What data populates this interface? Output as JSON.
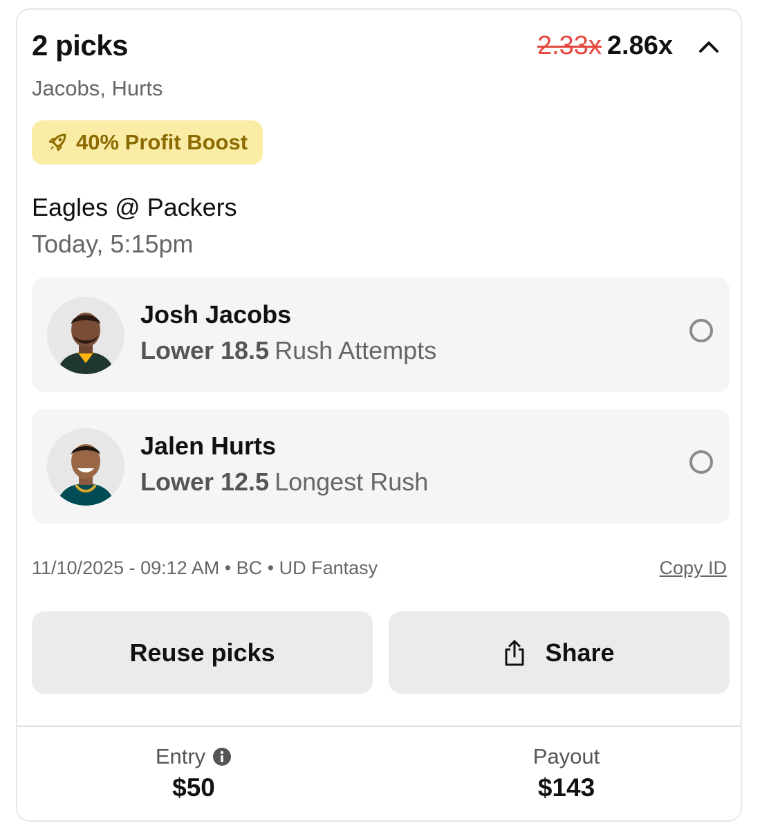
{
  "header": {
    "title": "2 picks",
    "old_multiplier": "2.33x",
    "new_multiplier": "2.86x",
    "subtitle": "Jacobs, Hurts"
  },
  "boost": {
    "label": "40% Profit Boost",
    "icon": "rocket-icon"
  },
  "game": {
    "matchup": "Eagles @ Packers",
    "time": "Today, 5:15pm"
  },
  "picks": [
    {
      "player": "Josh Jacobs",
      "direction": "Lower 18.5",
      "stat": "Rush Attempts",
      "jersey_color": "#203731"
    },
    {
      "player": "Jalen Hurts",
      "direction": "Lower 12.5",
      "stat": "Longest Rush",
      "jersey_color": "#004c54"
    }
  ],
  "meta": {
    "info": "11/10/2025 - 09:12 AM • BC • UD Fantasy",
    "copy_label": "Copy ID"
  },
  "actions": {
    "reuse_label": "Reuse picks",
    "share_label": "Share"
  },
  "footer": {
    "entry_label": "Entry",
    "entry_value": "$50",
    "payout_label": "Payout",
    "payout_value": "$143"
  },
  "colors": {
    "accent_red": "#e5483d",
    "boost_bg": "#fbeca5",
    "boost_text": "#8a6a00"
  }
}
